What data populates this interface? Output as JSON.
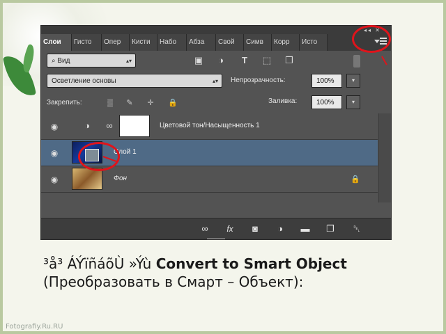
{
  "panel": {
    "tabs": [
      {
        "label": "Слои",
        "active": true
      },
      {
        "label": "Гисто",
        "active": false
      },
      {
        "label": "Опер",
        "active": false
      },
      {
        "label": "Кисти",
        "active": false
      },
      {
        "label": "Набо",
        "active": false
      },
      {
        "label": "Абза",
        "active": false
      },
      {
        "label": "Свой",
        "active": false
      },
      {
        "label": "Симв",
        "active": false
      },
      {
        "label": "Корр",
        "active": false
      },
      {
        "label": "Исто",
        "active": false
      }
    ],
    "collapse_glyph": "◂◂ ✕",
    "filter": {
      "value": "Вид"
    },
    "blend_mode": {
      "value": "Осветление основы"
    },
    "opacity": {
      "label": "Непрозрачность:",
      "value": "100%"
    },
    "lock": {
      "label": "Закрепить:"
    },
    "fill": {
      "label": "Заливка:",
      "value": "100%"
    },
    "layers": [
      {
        "name": "Цветовой тон/Насыщенность 1",
        "selected": false,
        "type": "adjustment"
      },
      {
        "name": "Слой 1",
        "selected": true,
        "type": "pixel"
      },
      {
        "name": "Фон",
        "selected": false,
        "type": "background",
        "locked": true
      }
    ],
    "bottom_icons": [
      "link-icon",
      "fx-icon",
      "mask-icon",
      "adjustment-icon",
      "folder-icon",
      "new-layer-icon",
      "trash-icon"
    ]
  },
  "caption": {
    "prefix": "³å³ ÁÝïñáõÙ »Ýù ",
    "bold": "Convert to Smart Object",
    "suffix": " (Преобразовать в Смарт – Объект):"
  },
  "watermark": "Fotografiy.Ru.RU",
  "colors": {
    "highlight": "#e0141b",
    "selected_layer": "#4f6a86",
    "panel": "#535353"
  }
}
